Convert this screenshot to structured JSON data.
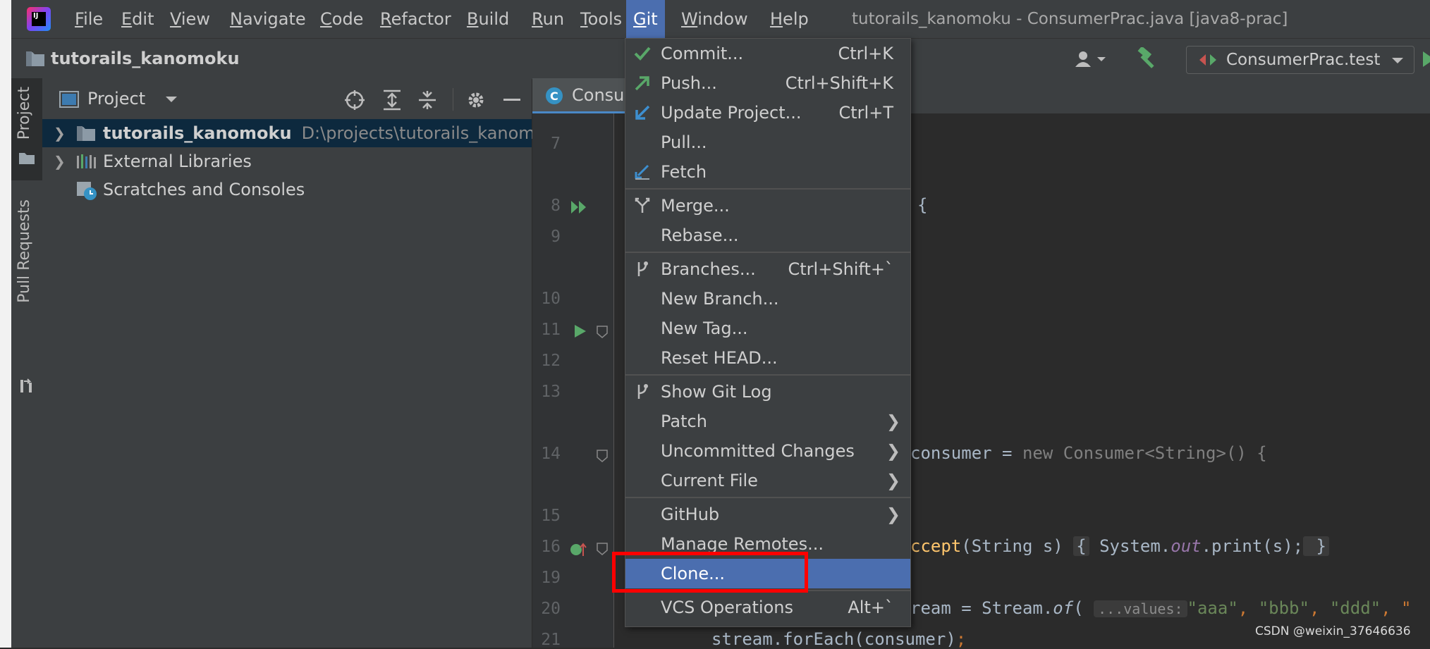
{
  "menubar": {
    "items": [
      {
        "label": "File",
        "u": "F",
        "rest": "ile"
      },
      {
        "label": "Edit",
        "u": "E",
        "rest": "dit"
      },
      {
        "label": "View",
        "u": "V",
        "rest": "iew"
      },
      {
        "label": "Navigate",
        "u": "N",
        "rest": "avigate"
      },
      {
        "label": "Code",
        "u": "C",
        "rest": "ode"
      },
      {
        "label": "Refactor",
        "u": "R",
        "rest": "efactor"
      },
      {
        "label": "Build",
        "u": "B",
        "rest": "uild"
      },
      {
        "label": "Run",
        "u": "R",
        "rest": "un"
      },
      {
        "label": "Tools",
        "u": "T",
        "rest": "ools"
      },
      {
        "label": "Git",
        "u": "G",
        "rest": "it"
      },
      {
        "label": "Window",
        "u": "W",
        "rest": "indow"
      },
      {
        "label": "Help",
        "u": "H",
        "rest": "elp"
      }
    ],
    "window_title": "tutorails_kanomoku - ConsumerPrac.java [java8-prac]"
  },
  "navbar": {
    "project": "tutorails_kanomoku",
    "run_config": "ConsumerPrac.test"
  },
  "toolstrip": {
    "project_tab": "Project",
    "pull_requests_tab": "Pull Requests"
  },
  "project_panel": {
    "title": "Project",
    "tree": [
      {
        "label": "tutorails_kanomoku",
        "path": "D:\\projects\\tutorails_kanomoku",
        "bold": true,
        "selected": true
      },
      {
        "label": "External Libraries"
      },
      {
        "label": "Scratches and Consoles"
      }
    ]
  },
  "editor": {
    "tab": "ConsumerPrac.java",
    "line_numbers": [
      "7",
      "8",
      "9",
      "10",
      "11",
      "12",
      "13",
      "14",
      "15",
      "16",
      "19",
      "20",
      "21"
    ],
    "code": {
      "l8": "{",
      "l14_a": "consumer = ",
      "l14_b": "new",
      "l14_c": " Consumer<String>() {",
      "l16_a": "ccept",
      "l16_b": "(String s) ",
      "l16_c": "{",
      "l16_d": " System.",
      "l16_e": "out",
      "l16_f": ".print(s);",
      "l16_g": " }",
      "l20_a": "ream = Stream.",
      "l20_b": "of",
      "l20_c": "( ",
      "l20_hint": "...values:",
      "l20_d": "\"aaa\"",
      "l20_e": ", ",
      "l20_f": "\"bbb\"",
      "l20_g": ", ",
      "l20_h": "\"ddd\"",
      "l20_i": ", \"",
      "l21_a": "stream.forEach(consumer)",
      "l21_b": ";"
    }
  },
  "git_menu": {
    "items": [
      {
        "label": "Commit...",
        "shortcut": "Ctrl+K"
      },
      {
        "label": "Push...",
        "shortcut": "Ctrl+Shift+K"
      },
      {
        "label": "Update Project...",
        "shortcut": "Ctrl+T"
      },
      {
        "label": "Pull..."
      },
      {
        "label": "Fetch"
      },
      {
        "label": "Merge..."
      },
      {
        "label": "Rebase..."
      },
      {
        "label": "Branches...",
        "shortcut": "Ctrl+Shift+`"
      },
      {
        "label": "New Branch..."
      },
      {
        "label": "New Tag..."
      },
      {
        "label": "Reset HEAD..."
      },
      {
        "label": "Show Git Log"
      },
      {
        "label": "Patch"
      },
      {
        "label": "Uncommitted Changes"
      },
      {
        "label": "Current File"
      },
      {
        "label": "GitHub"
      },
      {
        "label": "Manage Remotes..."
      },
      {
        "label": "Clone..."
      },
      {
        "label": "VCS Operations",
        "shortcut": "Alt+`"
      }
    ]
  },
  "colors": {
    "highlight": "#4b6eaf",
    "annotation_box": "#ff0000"
  },
  "watermark": "CSDN @weixin_37646636"
}
